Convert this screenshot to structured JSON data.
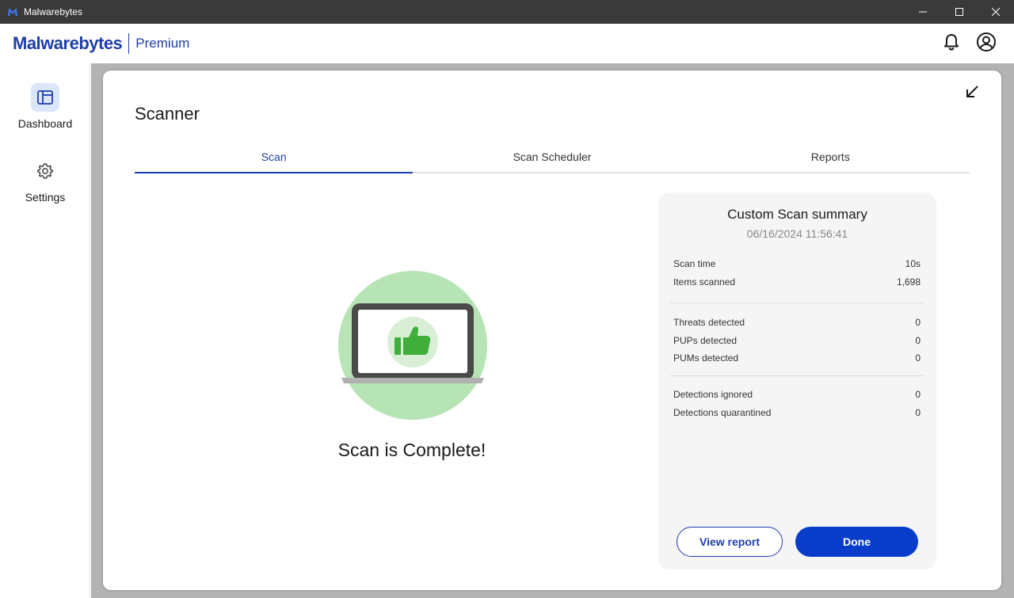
{
  "window": {
    "title": "Malwarebytes",
    "controls": [
      "minimize-icon",
      "maximize-icon",
      "close-icon"
    ]
  },
  "header": {
    "brand": "Malwarebytes",
    "tier": "Premium",
    "icons": [
      "bell-icon",
      "account-icon"
    ]
  },
  "sidebar": {
    "items": [
      {
        "label": "Dashboard",
        "icon": "dashboard-icon",
        "active": true
      },
      {
        "label": "Settings",
        "icon": "gear-icon",
        "active": false
      }
    ]
  },
  "scanner": {
    "title": "Scanner",
    "tabs": [
      {
        "label": "Scan",
        "active": true
      },
      {
        "label": "Scan Scheduler",
        "active": false
      },
      {
        "label": "Reports",
        "active": false
      }
    ],
    "status_text": "Scan is Complete!"
  },
  "summary": {
    "title": "Custom Scan summary",
    "date": "06/16/2024 11:56:41",
    "groups": [
      [
        {
          "label": "Scan time",
          "value": "10s"
        },
        {
          "label": "Items scanned",
          "value": "1,698"
        }
      ],
      [
        {
          "label": "Threats detected",
          "value": "0"
        },
        {
          "label": "PUPs detected",
          "value": "0"
        },
        {
          "label": "PUMs detected",
          "value": "0"
        }
      ],
      [
        {
          "label": "Detections ignored",
          "value": "0"
        },
        {
          "label": "Detections quarantined",
          "value": "0"
        }
      ]
    ],
    "view_report_label": "View report",
    "done_label": "Done"
  },
  "colors": {
    "accent": "#1e3ea8",
    "primary_button": "#0a3ccc",
    "success_light": "#b7e4b5",
    "success": "#3fae3b"
  }
}
